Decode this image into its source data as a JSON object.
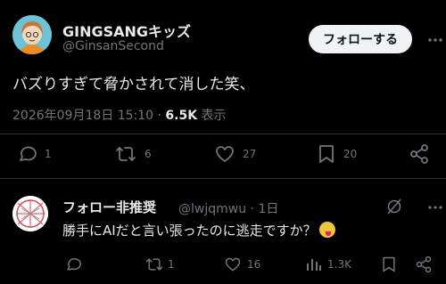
{
  "main_tweet": {
    "display_name": "GINGSANGキッズ",
    "handle": "@GinsanSecond",
    "follow_label": "フォローする",
    "text": "バズりすぎて脅かされて消した笑、",
    "datetime": "2026年09月18日 15:10",
    "separator": " · ",
    "views_count": "6.5K",
    "views_label": "表示",
    "stats": {
      "replies": "1",
      "retweets": "6",
      "likes": "27",
      "bookmarks": "20"
    },
    "colors": {
      "avatar_bg": "#6ec2d6",
      "hair": "#c07a3c",
      "shirt": "#f08a24"
    }
  },
  "reply": {
    "display_name": "フォロー非推奨",
    "handle": "@lwjqmwu",
    "separator": " · ",
    "time": "1日",
    "text": "勝手にAIだと言い張ったのに逃走ですか？",
    "emoji": "zany-face-emoji",
    "stats": {
      "retweets": "1",
      "likes": "16",
      "views": "1.3K"
    }
  },
  "icons": [
    "more-icon",
    "reply-icon",
    "retweet-icon",
    "like-icon",
    "bookmark-icon",
    "share-icon",
    "grok-icon",
    "views-icon"
  ]
}
